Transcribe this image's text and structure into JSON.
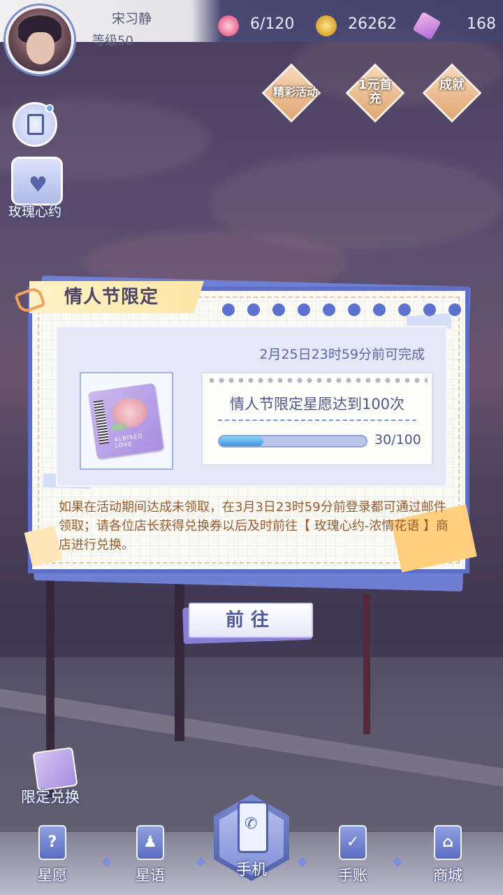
{
  "player": {
    "name": "宋习静",
    "level": "等级50"
  },
  "resources": {
    "stamina": "6/120",
    "gold": "26262",
    "diamonds": "168"
  },
  "side": {
    "rose_contract_label": "玫瑰心约"
  },
  "top_buttons": {
    "event_label": "精彩活动",
    "first_recharge_label": "1元首充",
    "achievement_label": "成就"
  },
  "dialog": {
    "title": "情人节限定",
    "deadline": "2月25日23时59分前可完成",
    "task_name": "情人节限定星愿达到100次",
    "progress_text": "30/100",
    "progress_fraction": 0.3,
    "card_text": "ALBIREO LOVE",
    "note": "如果在活动期间达成未领取，在3月3日23时59分前登录都可通过邮件领取；请各位店长获得兑换券以后及时前往【 玫瑰心约-浓情花语 】商店进行兑换。"
  },
  "go_button": "前往",
  "exchange_label": "限定兑换",
  "nav": {
    "wish": "星愿",
    "star_words": "星语",
    "phone": "手机",
    "notebook": "手账",
    "shop": "商城"
  }
}
